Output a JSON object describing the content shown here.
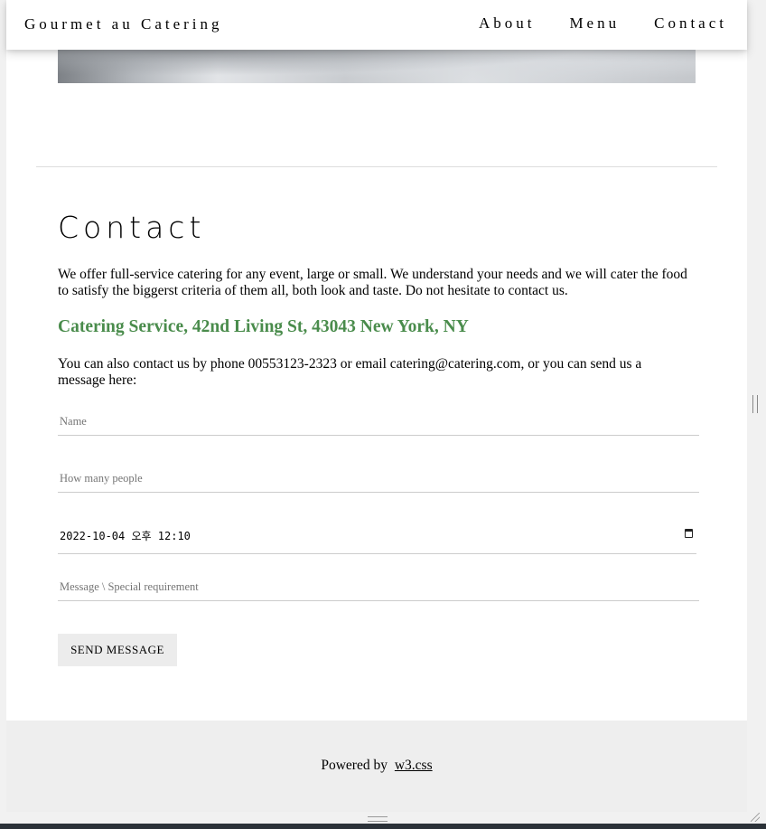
{
  "navbar": {
    "brand": "Gourmet au Catering",
    "links": [
      "About",
      "Menu",
      "Contact"
    ]
  },
  "contact": {
    "heading": "Contact",
    "intro": "We offer full-service catering for any event, large or small. We understand your needs and we will cater the food to satisfy the biggerst criteria of them all, both look and taste. Do not hesitate to contact us.",
    "address": "Catering Service, 42nd Living St, 43043 New York, NY",
    "contact_text": "You can also contact us by phone 00553123-2323 or email catering@catering.com, or you can send us a message here:",
    "form": {
      "name_placeholder": "Name",
      "people_placeholder": "How many people",
      "datetime_value": "2022-10-04 오후 12:10",
      "message_placeholder": "Message \\ Special requirement",
      "submit_label": "SEND MESSAGE"
    }
  },
  "footer": {
    "text": "Powered by",
    "link": "w3.css"
  },
  "colors": {
    "address_green": "#4a8c4c",
    "footer_bg": "#eeeeee",
    "button_bg": "#ececec"
  }
}
